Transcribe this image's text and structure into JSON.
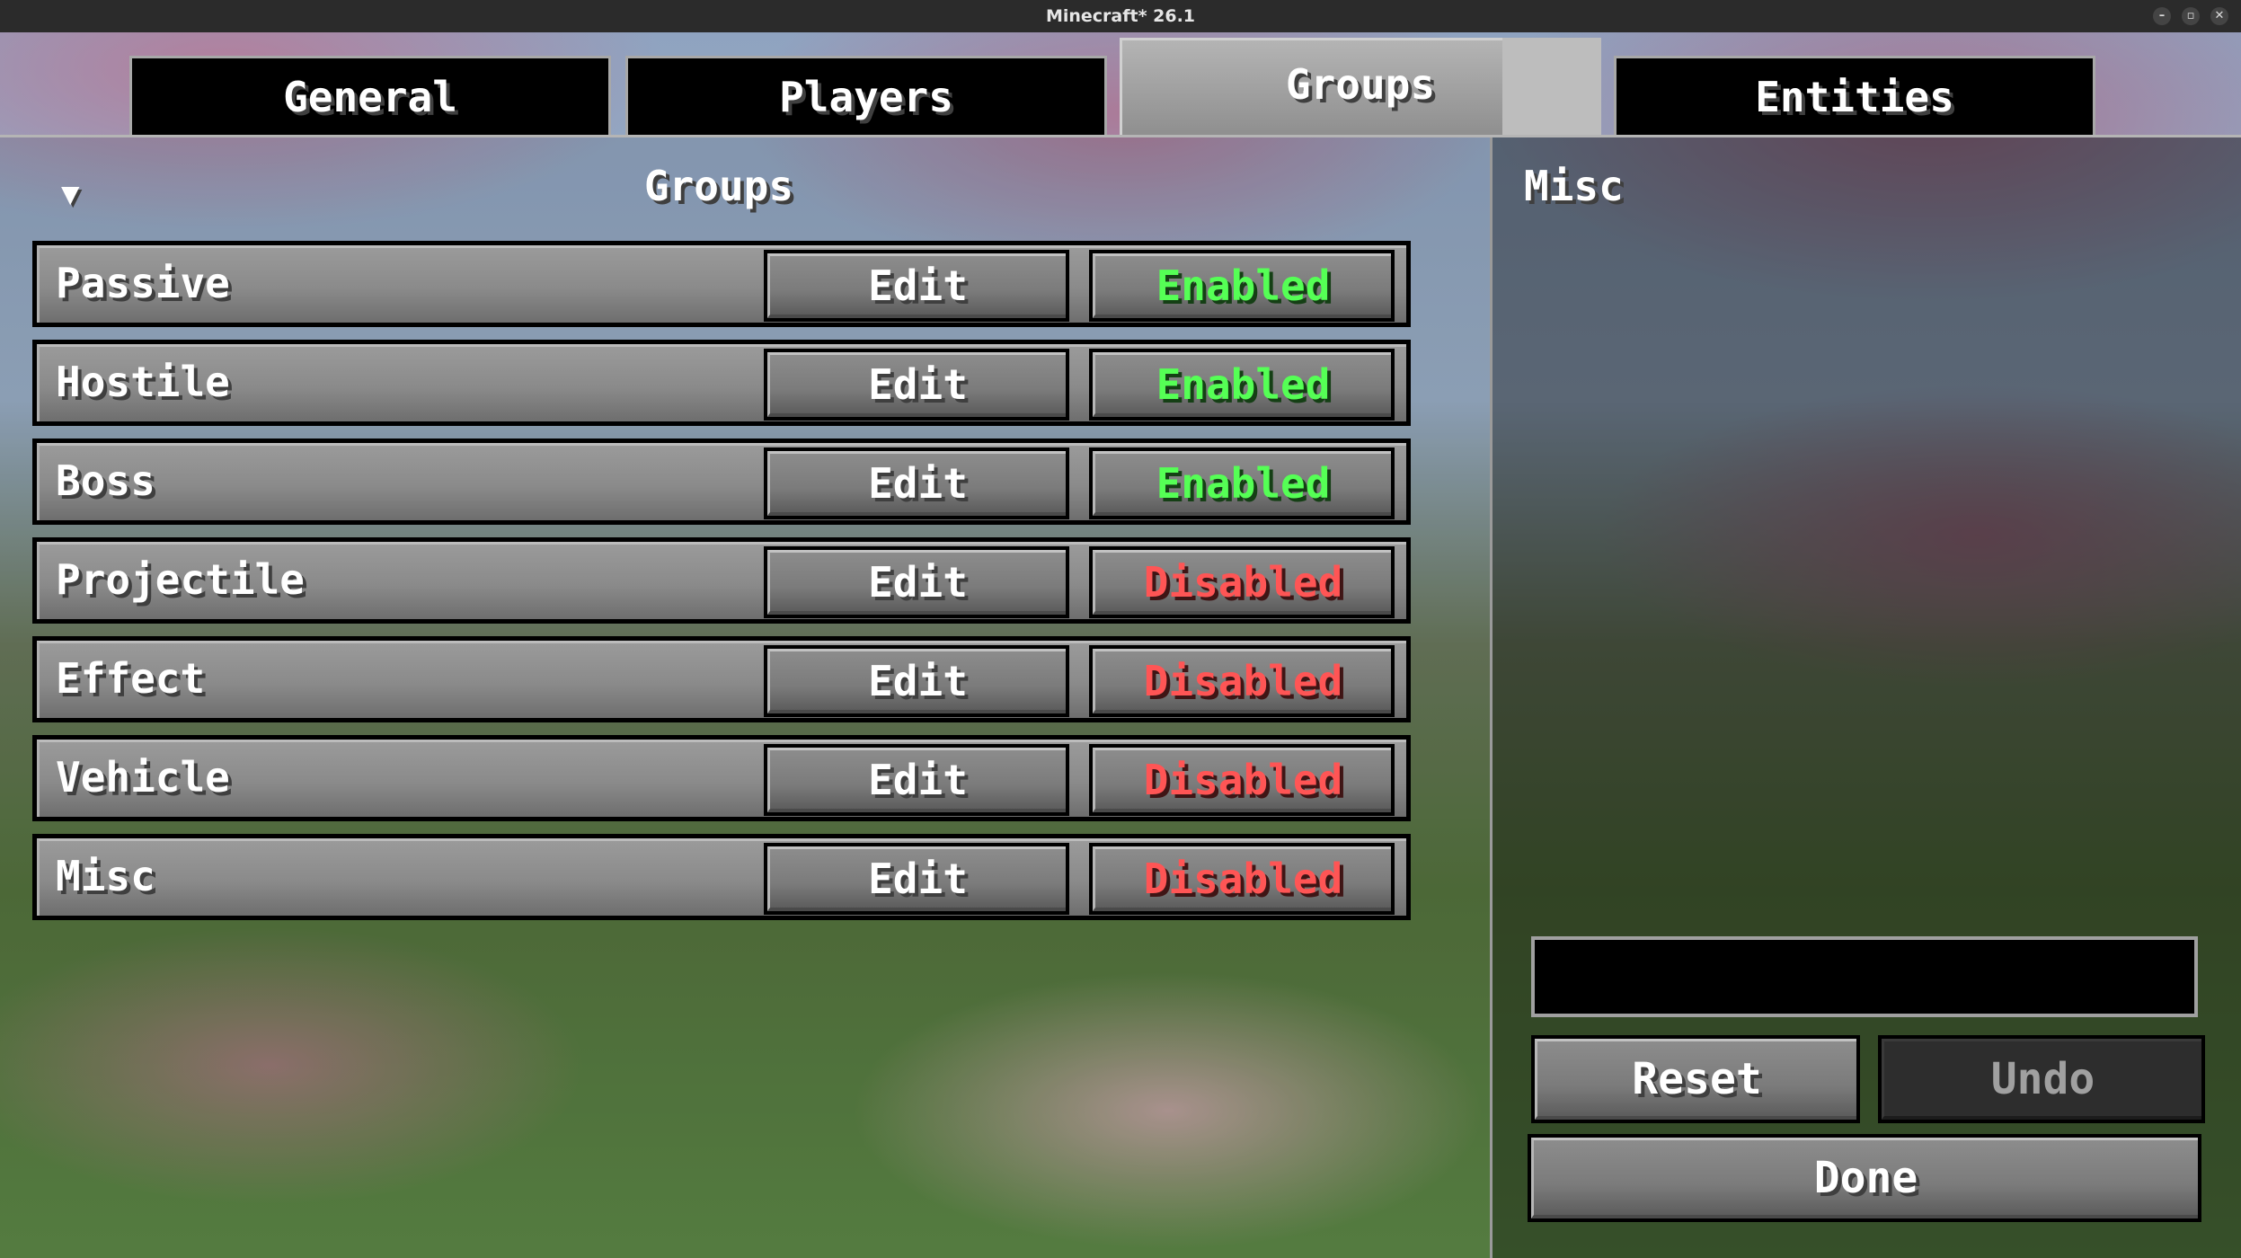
{
  "window": {
    "title": "Minecraft* 26.1",
    "controls": [
      "–",
      "▫",
      "✕"
    ]
  },
  "tabs": [
    {
      "label": "General",
      "active": false
    },
    {
      "label": "Players",
      "active": false
    },
    {
      "label": "Groups",
      "active": true
    },
    {
      "label": "Entities",
      "active": false
    }
  ],
  "list": {
    "collapse_icon": "▼",
    "title": "Groups",
    "rows": [
      {
        "name": "Passive",
        "edit_label": "Edit",
        "state_label": "Enabled",
        "enabled": true
      },
      {
        "name": "Hostile",
        "edit_label": "Edit",
        "state_label": "Enabled",
        "enabled": true
      },
      {
        "name": "Boss",
        "edit_label": "Edit",
        "state_label": "Enabled",
        "enabled": true
      },
      {
        "name": "Projectile",
        "edit_label": "Edit",
        "state_label": "Disabled",
        "enabled": false
      },
      {
        "name": "Effect",
        "edit_label": "Edit",
        "state_label": "Disabled",
        "enabled": false
      },
      {
        "name": "Vehicle",
        "edit_label": "Edit",
        "state_label": "Disabled",
        "enabled": false
      },
      {
        "name": "Misc",
        "edit_label": "Edit",
        "state_label": "Disabled",
        "enabled": false
      }
    ]
  },
  "panel": {
    "title": "Misc",
    "input_value": "",
    "reset_label": "Reset",
    "undo_label": "Undo",
    "done_label": "Done"
  },
  "colors": {
    "enabled": "#55ff55",
    "disabled": "#ff5555"
  }
}
